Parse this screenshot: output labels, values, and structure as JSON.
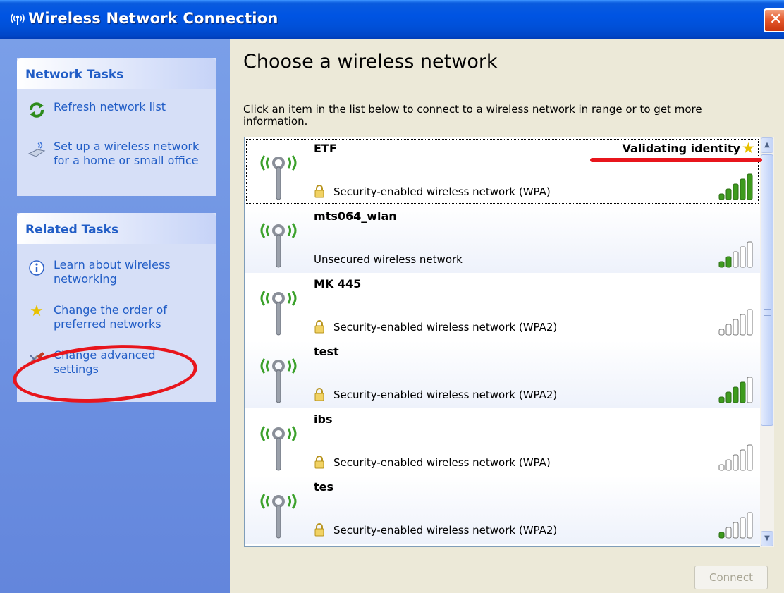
{
  "window": {
    "title": "Wireless Network Connection",
    "icon": "wireless-network-icon",
    "close_icon": "close-icon"
  },
  "network_tasks": {
    "header": "Network Tasks",
    "items": [
      {
        "label": "Refresh network list",
        "icon": "refresh-icon"
      },
      {
        "label_line1": "Set up a wireless network",
        "label_line2": "for a home or small office",
        "icon": "wireless-setup-icon"
      }
    ]
  },
  "related_tasks": {
    "header": "Related Tasks",
    "items": [
      {
        "label_line1": "Learn about wireless",
        "label_line2": "networking",
        "icon": "info-icon"
      },
      {
        "label_line1": "Change the order of",
        "label_line2": "preferred networks",
        "icon": "star-icon"
      },
      {
        "label_line1": "Change advanced",
        "label_line2": "settings",
        "icon": "settings-icon"
      }
    ]
  },
  "main": {
    "heading": "Choose a wireless network",
    "instructions_line1": "Click an item in the list below to connect to a wireless network in range or to get more",
    "instructions_line2": "information."
  },
  "networks": [
    {
      "name": "ETF",
      "security": "Security-enabled wireless network (WPA)",
      "secured": true,
      "status": "Validating identity",
      "signal_bars": 5,
      "selected": true
    },
    {
      "name": "mts064_wlan",
      "security": "Unsecured wireless network",
      "secured": false,
      "status": "",
      "signal_bars": 2,
      "selected": false
    },
    {
      "name": "MK 445",
      "security": "Security-enabled wireless network (WPA2)",
      "secured": true,
      "status": "",
      "signal_bars": 0,
      "selected": false
    },
    {
      "name": "test",
      "security": "Security-enabled wireless network (WPA2)",
      "secured": true,
      "status": "",
      "signal_bars": 4,
      "selected": false
    },
    {
      "name": "ibs",
      "security": "Security-enabled wireless network (WPA)",
      "secured": true,
      "status": "",
      "signal_bars": 0,
      "selected": false
    },
    {
      "name": "tes",
      "security": "Security-enabled wireless network (WPA2)",
      "secured": true,
      "status": "",
      "signal_bars": 1,
      "selected": false
    }
  ],
  "buttons": {
    "connect": "Connect"
  },
  "colors": {
    "accent": "#215DC6",
    "signal_on": "#3E9B1E",
    "signal_off": "#FFFFFF",
    "annotation": "#E8151C"
  }
}
